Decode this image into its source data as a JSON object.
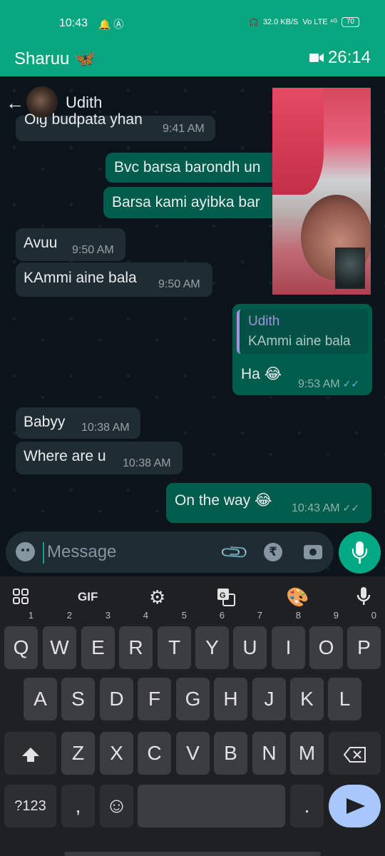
{
  "status_bar": {
    "time": "10:43",
    "left_icons": "🔔 Ⓐ",
    "network_speed": "32.0 KB/S",
    "network": "Vo LTE ⁴ᴳ",
    "battery": "70"
  },
  "call_banner": {
    "name": "Sharuu 🦋",
    "timer": "26:14",
    "video_icon": "video-camera-icon"
  },
  "chat_header": {
    "contact_name": "Udith",
    "back_icon": "arrow-left-icon"
  },
  "messages": [
    {
      "dir": "in",
      "text": "Oig budpata yhan",
      "time": "9:41 AM"
    },
    {
      "dir": "out",
      "text": "Bvc barsa barondh un"
    },
    {
      "dir": "out",
      "text": "Barsa kami ayibka bar"
    },
    {
      "dir": "in",
      "text": "Avuu",
      "time": "9:50 AM"
    },
    {
      "dir": "in",
      "text": "KAmmi aine bala",
      "time": "9:50 AM"
    },
    {
      "dir": "out",
      "quote_author": "Udith",
      "quote_text": "KAmmi aine bala",
      "text": "Ha 😂",
      "time": "9:53 AM",
      "ticks": "✓✓",
      "read": true
    },
    {
      "dir": "in",
      "text": "Babyy",
      "time": "10:38 AM"
    },
    {
      "dir": "in",
      "text": "Where are u",
      "time": "10:38 AM"
    },
    {
      "dir": "out",
      "text": "On the way 😂",
      "time": "10:43 AM",
      "ticks": "✓✓",
      "read": false
    }
  ],
  "input": {
    "placeholder": "Message",
    "rupee": "₹"
  },
  "keyboard": {
    "toolbar": {
      "gif": "GIF"
    },
    "row1": [
      {
        "key": "Q",
        "hint": "1"
      },
      {
        "key": "W",
        "hint": "2"
      },
      {
        "key": "E",
        "hint": "3"
      },
      {
        "key": "R",
        "hint": "4"
      },
      {
        "key": "T",
        "hint": "5"
      },
      {
        "key": "Y",
        "hint": "6"
      },
      {
        "key": "U",
        "hint": "7"
      },
      {
        "key": "I",
        "hint": "8"
      },
      {
        "key": "O",
        "hint": "9"
      },
      {
        "key": "P",
        "hint": "0"
      }
    ],
    "row2": [
      "A",
      "S",
      "D",
      "F",
      "G",
      "H",
      "J",
      "K",
      "L"
    ],
    "row3": [
      "Z",
      "X",
      "C",
      "V",
      "B",
      "N",
      "M"
    ],
    "symbols": "?123",
    "comma": ",",
    "period": ".",
    "emoji_key": "☺"
  },
  "colors": {
    "accent": "#00a884",
    "banner": "#07a67e",
    "bubble_out": "#005c4b",
    "bubble_in": "#202c33",
    "background": "#0b141a",
    "tick_read": "#53bdeb"
  }
}
